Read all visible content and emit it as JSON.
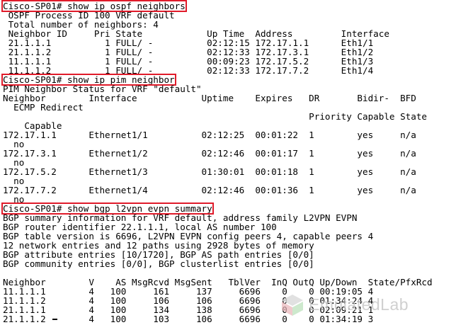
{
  "terminal": {
    "lines": [
      {
        "text": "Cisco-SP01# show ip ospf neighbors",
        "boxed": true
      },
      {
        "text": " OSPF Process ID 100 VRF default",
        "boxed": false
      },
      {
        "text": " Total number of neighbors: 4",
        "boxed": false
      },
      {
        "text": " Neighbor ID     Pri State            Up Time  Address         Interface",
        "boxed": false
      },
      {
        "text": " 21.1.1.1          1 FULL/ -          02:12:15 172.17.1.1      Eth1/1",
        "boxed": false
      },
      {
        "text": " 21.1.1.2          1 FULL/ -          02:12:33 172.17.3.1      Eth1/2",
        "boxed": false
      },
      {
        "text": " 11.1.1.1          1 FULL/ -          00:09:23 172.17.5.2      Eth1/3",
        "boxed": false
      },
      {
        "text": " 11.1.1.2          1 FULL/ -          02:12:33 172.17.7.2      Eth1/4",
        "boxed": false
      },
      {
        "text": "Cisco-SP01# show ip pim neighbor",
        "boxed": true
      },
      {
        "text": "PIM Neighbor Status for VRF \"default\"",
        "boxed": false
      },
      {
        "text": "Neighbor        Interface            Uptime    Expires   DR       Bidir-  BFD",
        "boxed": false
      },
      {
        "text": "  ECMP Redirect",
        "boxed": false
      },
      {
        "text": "                                                         Priority Capable State",
        "boxed": false
      },
      {
        "text": "    Capable",
        "boxed": false
      },
      {
        "text": "172.17.1.1      Ethernet1/1          02:12:25  00:01:22  1        yes     n/a",
        "boxed": false
      },
      {
        "text": "  no",
        "boxed": false
      },
      {
        "text": "172.17.3.1      Ethernet1/2          02:12:46  00:01:17  1        yes     n/a",
        "boxed": false
      },
      {
        "text": "  no",
        "boxed": false
      },
      {
        "text": "172.17.5.2      Ethernet1/3          01:30:01  00:01:18  1        yes     n/a",
        "boxed": false
      },
      {
        "text": "  no",
        "boxed": false
      },
      {
        "text": "172.17.7.2      Ethernet1/4          02:12:46  00:01:36  1        yes     n/a",
        "boxed": false
      },
      {
        "text": "  no",
        "boxed": false
      },
      {
        "text": "Cisco-SP01# show bgp l2vpn evpn summary",
        "boxed": true
      },
      {
        "text": "BGP summary information for VRF default, address family L2VPN EVPN",
        "boxed": false
      },
      {
        "text": "BGP router identifier 22.1.1.1, local AS number 100",
        "boxed": false
      },
      {
        "text": "BGP table version is 6696, L2VPN EVPN config peers 4, capable peers 4",
        "boxed": false
      },
      {
        "text": "12 network entries and 12 paths using 2928 bytes of memory",
        "boxed": false
      },
      {
        "text": "BGP attribute entries [10/1720], BGP AS path entries [0/0]",
        "boxed": false
      },
      {
        "text": "BGP community entries [0/0], BGP clusterlist entries [0/0]",
        "boxed": false
      },
      {
        "text": "",
        "boxed": false
      },
      {
        "text": "Neighbor        V    AS MsgRcvd MsgSent   TblVer  InQ OutQ Up/Down  State/PfxRcd",
        "boxed": false
      },
      {
        "text": "11.1.1.1        4   100     161     137     6696    0    0 00:19:05 4",
        "boxed": false
      },
      {
        "text": "11.1.1.2        4   100     106     106     6696    0    0 01:34:24 4",
        "boxed": false
      },
      {
        "text": "21.1.1.1        4   100     134     138     6696    0    0 02:09:21 1",
        "boxed": false
      },
      {
        "text": "21.1.1.2        4   100     103     106     6696    0    0 01:34:19 3",
        "boxed": false
      }
    ]
  },
  "watermark": {
    "text": "EmulatedLab",
    "icon": "emulatedlab-logo-icon"
  },
  "colors": {
    "highlight_box": "#e01b2a",
    "text": "#000000",
    "background": "#ffffff"
  }
}
